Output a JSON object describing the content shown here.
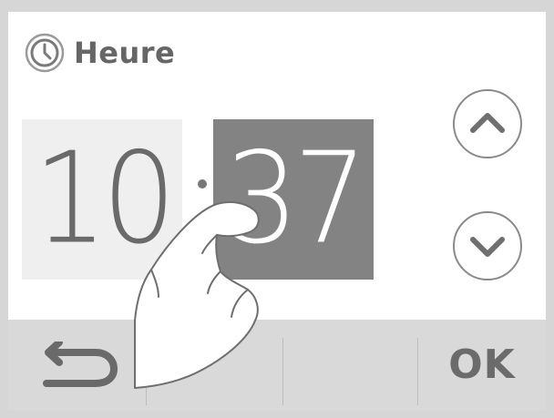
{
  "header": {
    "icon": "clock-icon",
    "title": "Heure"
  },
  "time": {
    "hours": "10",
    "separator": ":",
    "minutes": "37",
    "selected_field": "minutes"
  },
  "controls": {
    "up_icon": "chevron-up-icon",
    "down_icon": "chevron-down-icon"
  },
  "bottom_bar": {
    "back_icon": "back-arrow-icon",
    "ok_label": "OK"
  },
  "colors": {
    "selected_field_bg": "#838383",
    "unselected_field_bg": "#efefef",
    "bar_bg": "#d9d9d9",
    "text_gray": "#6b6b6b"
  }
}
